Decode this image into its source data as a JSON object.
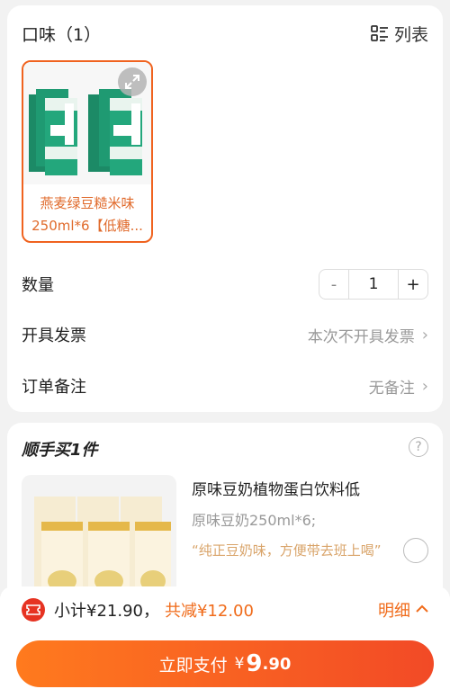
{
  "flavor": {
    "title": "口味（1）",
    "list_label": "列表",
    "product_caption_line1": "燕麦绿豆糙米味",
    "product_caption_line2": "250ml*6【低糖..."
  },
  "quantity": {
    "label": "数量",
    "minus": "-",
    "value": "1",
    "plus": "+"
  },
  "invoice": {
    "label": "开具发票",
    "value": "本次不开具发票"
  },
  "note": {
    "label": "订单备注",
    "value": "无备注"
  },
  "addon": {
    "title": "顺手买1件",
    "help": "?",
    "name": "原味豆奶植物蛋白饮料低",
    "spec": "原味豆奶250ml*6;",
    "desc": "“纯正豆奶味，方便带去班上喝”"
  },
  "summary": {
    "subtotal": "小计¥21.90，",
    "discount": "共减¥12.00",
    "detail": "明细"
  },
  "pay": {
    "label": "立即支付",
    "currency": "¥",
    "amount": "9",
    "decimal": ".90"
  },
  "colors": {
    "accent": "#f06b1a",
    "button_gradient_start": "#ff7a1e",
    "button_gradient_end": "#f24a26",
    "tile_border": "#f0631f"
  },
  "icons": [
    "list-icon",
    "expand-icon",
    "chevron-right-icon",
    "help-icon",
    "coupon-icon",
    "chevron-up-icon"
  ]
}
